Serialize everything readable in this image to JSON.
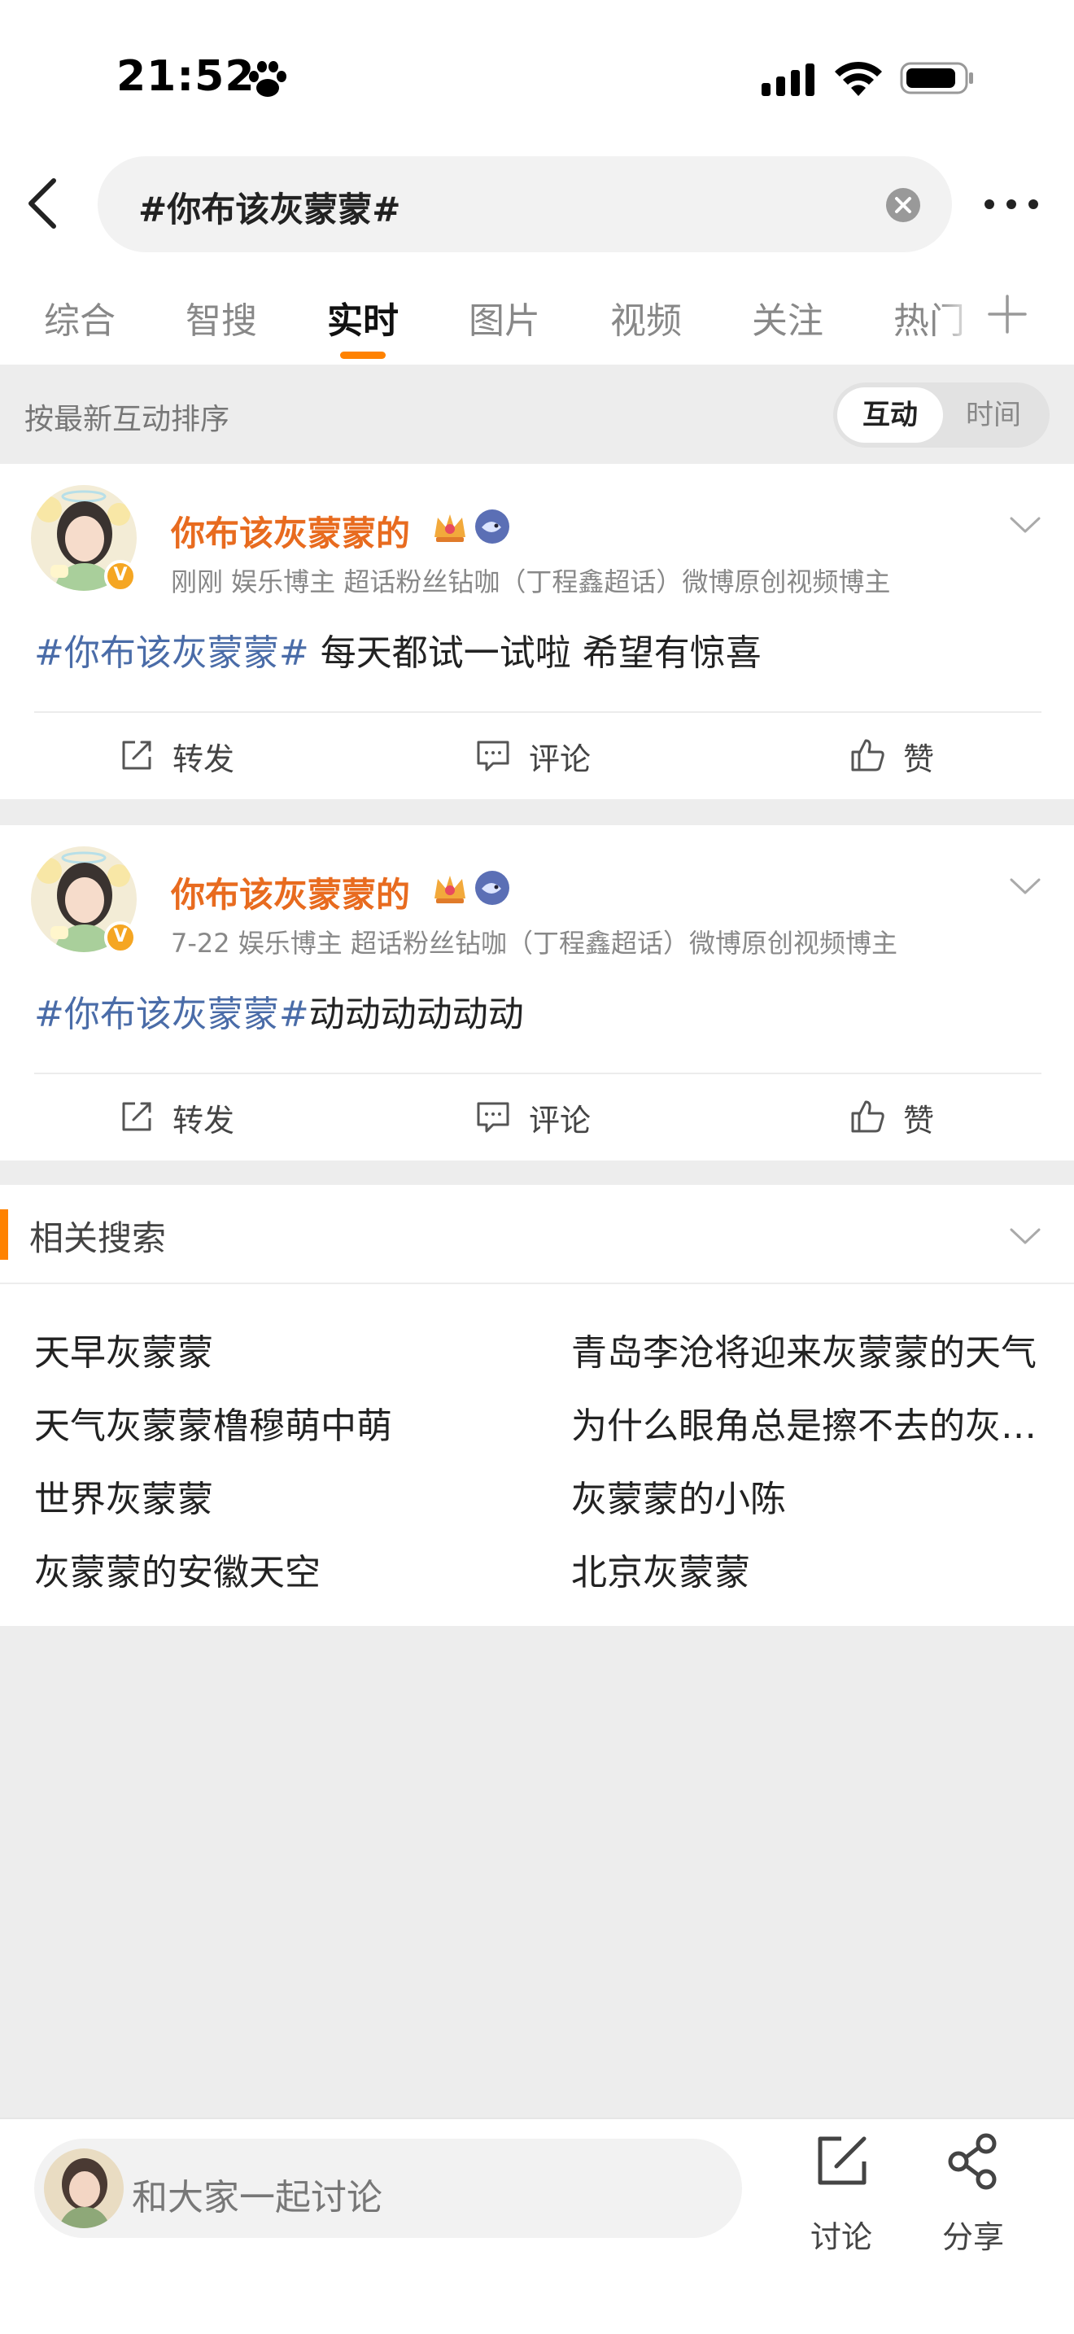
{
  "status_bar": {
    "time": "21:52"
  },
  "search": {
    "query": "#你布该灰蒙蒙#"
  },
  "tabs": [
    {
      "label": "综合"
    },
    {
      "label": "智搜"
    },
    {
      "label": "实时"
    },
    {
      "label": "图片"
    },
    {
      "label": "视频"
    },
    {
      "label": "关注"
    },
    {
      "label": "热门"
    }
  ],
  "active_tab": "实时",
  "sort": {
    "label": "按最新互动排序",
    "options": [
      "互动",
      "时间"
    ],
    "selected": "互动"
  },
  "posts": [
    {
      "author": "你布该灰蒙蒙的",
      "meta": "刚刚  娱乐博主 超话粉丝钻咖（丁程鑫超话）微博原创视频博主",
      "hashtag": "#你布该灰蒙蒙#",
      "text": " 每天都试一试啦 希望有惊喜",
      "actions": {
        "repost": "转发",
        "comment": "评论",
        "like": "赞"
      }
    },
    {
      "author": "你布该灰蒙蒙的",
      "meta": "7-22  娱乐博主 超话粉丝钻咖（丁程鑫超话）微博原创视频博主",
      "hashtag": "#你布该灰蒙蒙#",
      "text": "动动动动动动",
      "actions": {
        "repost": "转发",
        "comment": "评论",
        "like": "赞"
      }
    }
  ],
  "related": {
    "title": "相关搜索",
    "items": [
      "天早灰蒙蒙",
      "青岛李沧将迎来灰蒙蒙的天气",
      "天气灰蒙蒙橹穆萌中萌",
      "为什么眼角总是擦不去的灰蒙蒙",
      "世界灰蒙蒙",
      "灰蒙蒙的小陈",
      "灰蒙蒙的安徽天空",
      "北京灰蒙蒙"
    ]
  },
  "bottom_bar": {
    "comment_placeholder": "和大家一起讨论",
    "discuss_label": "讨论",
    "share_label": "分享"
  },
  "colors": {
    "accent": "#ff8200",
    "author": "#e86b1f",
    "hashtag": "#4a6ca8",
    "background": "#ededed"
  },
  "icons": [
    "paw-icon",
    "signal-icon",
    "wifi-icon",
    "battery-icon",
    "back-icon",
    "clear-icon",
    "more-icon",
    "plus-icon",
    "crown-icon",
    "fish-icon",
    "chevron-down-icon",
    "repost-icon",
    "comment-icon",
    "like-icon",
    "discuss-icon",
    "share-icon"
  ]
}
